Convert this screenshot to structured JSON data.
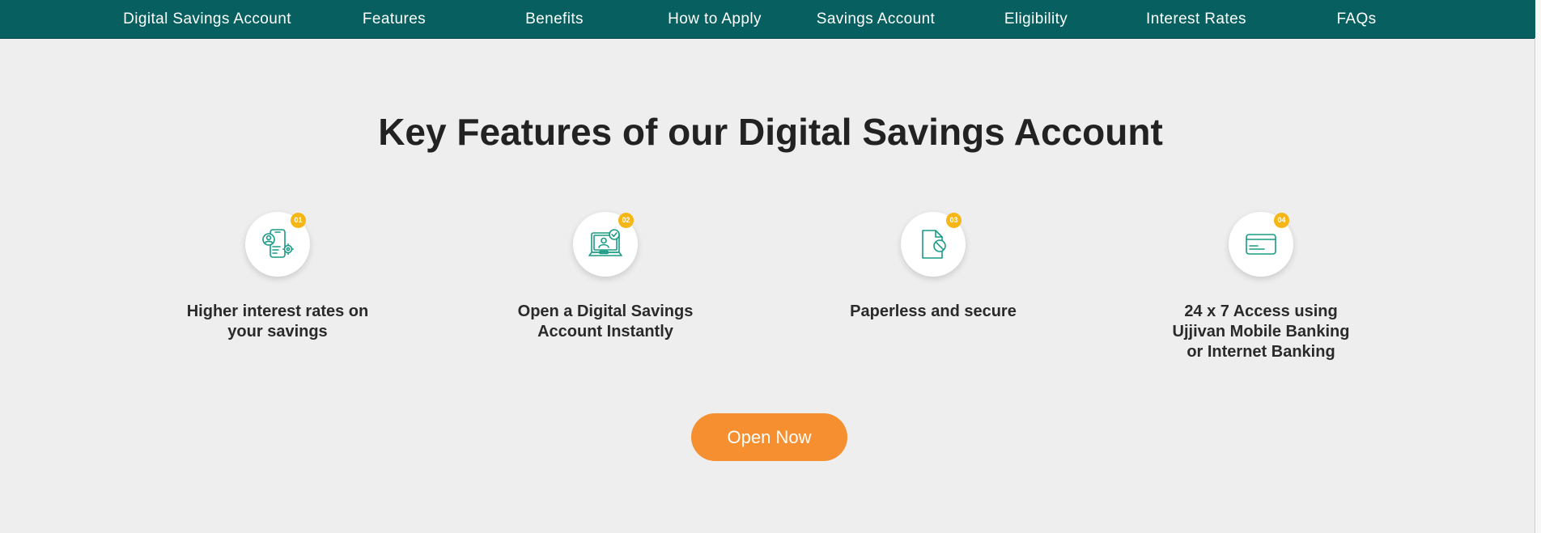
{
  "nav": {
    "items": [
      {
        "label": "Digital Savings Account"
      },
      {
        "label": "Features"
      },
      {
        "label": "Benefits"
      },
      {
        "label": "How to Apply"
      },
      {
        "label": "Savings Account"
      },
      {
        "label": "Eligibility"
      },
      {
        "label": "Interest Rates"
      },
      {
        "label": "FAQs"
      }
    ]
  },
  "section": {
    "title": "Key Features of our Digital Savings Account"
  },
  "features": [
    {
      "badge": "01",
      "icon": "phone-user-settings-icon",
      "text": "Higher interest rates on your savings"
    },
    {
      "badge": "02",
      "icon": "laptop-user-check-icon",
      "text": "Open a Digital Savings Account Instantly"
    },
    {
      "badge": "03",
      "icon": "paperless-document-icon",
      "text": "Paperless and secure"
    },
    {
      "badge": "04",
      "icon": "card-icon",
      "text": "24 x 7 Access using Ujjivan Mobile Banking or Internet Banking"
    }
  ],
  "cta": {
    "label": "Open Now"
  },
  "colors": {
    "nav_bg": "#075f5f",
    "page_bg": "#eeeeee",
    "accent_teal": "#1a9b86",
    "badge": "#f6b615",
    "cta": "#f58f2f"
  }
}
